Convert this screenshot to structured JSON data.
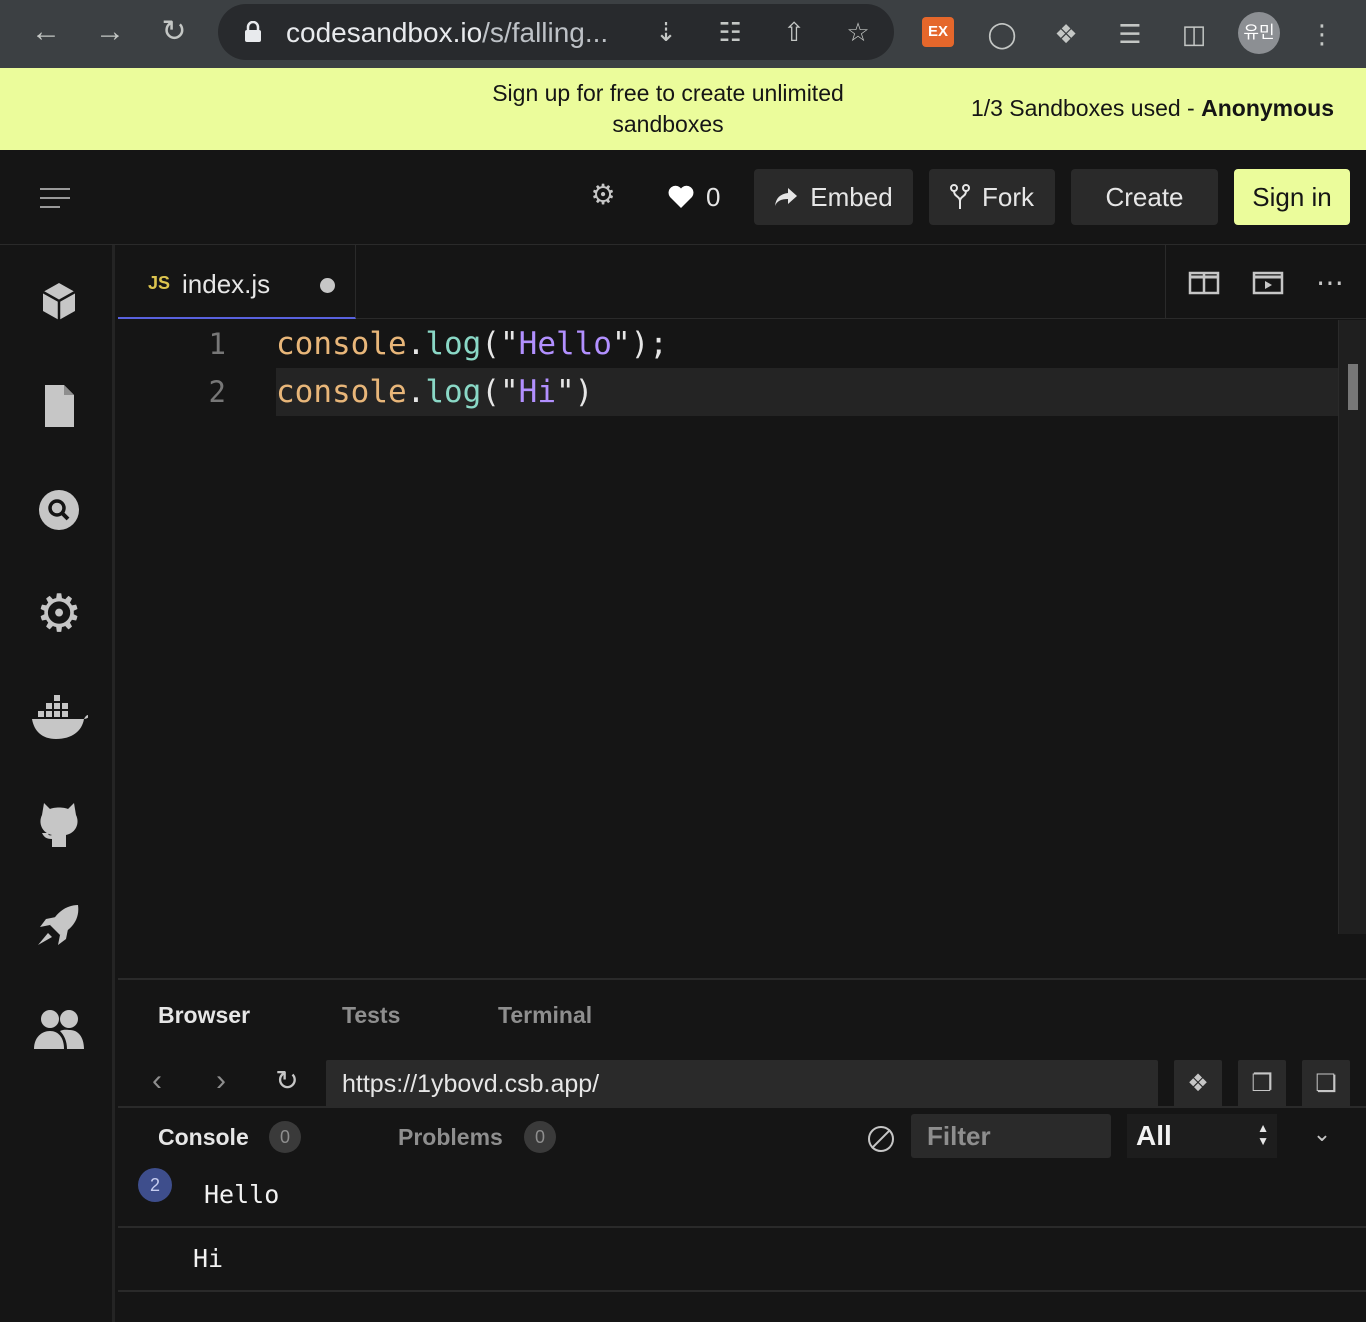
{
  "browser": {
    "url_host": "codesandbox.io",
    "url_path": "/s/falling...",
    "profile_label": "유민",
    "extension_badge": "EX"
  },
  "banner": {
    "message": "Sign up for free to create unlimited sandboxes",
    "usage_text": "1/3 Sandboxes used - ",
    "usage_user": "Anonymous",
    "bg_color": "#ebfc9b"
  },
  "toolbar": {
    "likes_count": "0",
    "embed_label": "Embed",
    "fork_label": "Fork",
    "create_label": "Create",
    "signin_label": "Sign in"
  },
  "sidebar": {
    "icons": [
      "cube-icon",
      "file-icon",
      "search-icon",
      "gear-icon",
      "docker-icon",
      "github-icon",
      "rocket-icon",
      "users-icon"
    ]
  },
  "editor": {
    "tab": {
      "badge": "JS",
      "filename": "index.js",
      "unsaved": true
    },
    "lines": [
      {
        "number": "1",
        "object": "console",
        "dot": ".",
        "method": "log",
        "open": "(\"",
        "string": "Hello",
        "close": "\");"
      },
      {
        "number": "2",
        "object": "console",
        "dot": ".",
        "method": "log",
        "open": "(\"",
        "string": "Hi",
        "close": "\")"
      }
    ]
  },
  "panel": {
    "tabs": [
      "Browser",
      "Tests",
      "Terminal"
    ],
    "active_tab": "Browser",
    "preview_url": "https://1ybovd.csb.app/"
  },
  "console": {
    "console_label": "Console",
    "console_count": "0",
    "problems_label": "Problems",
    "problems_count": "0",
    "filter_placeholder": "Filter",
    "level_selected": "All",
    "logs": [
      {
        "count": "2",
        "message": "Hello"
      },
      {
        "message": "Hi"
      }
    ]
  }
}
